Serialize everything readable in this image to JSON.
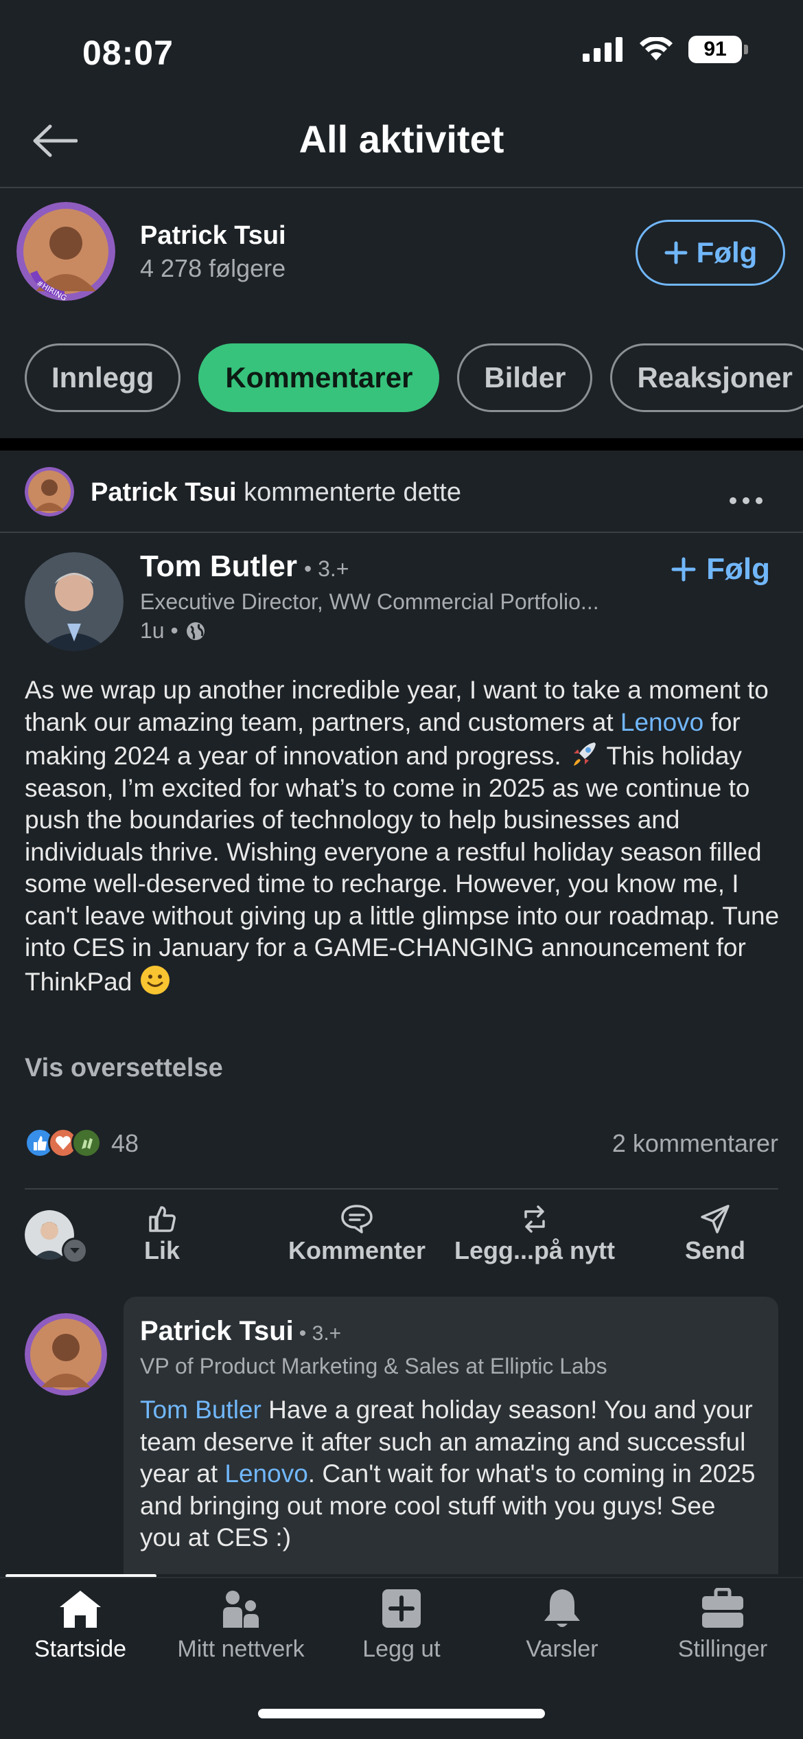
{
  "status_bar": {
    "time": "08:07",
    "battery": "91"
  },
  "header": {
    "title": "All aktivitet"
  },
  "profile": {
    "name": "Patrick Tsui",
    "followers": "4 278 følgere",
    "follow_label": "Følg",
    "avatar_badge": "#HIRING"
  },
  "filters": [
    {
      "label": "Innlegg",
      "active": false
    },
    {
      "label": "Kommentarer",
      "active": true
    },
    {
      "label": "Bilder",
      "active": false
    },
    {
      "label": "Reaksjoner",
      "active": false
    }
  ],
  "activity": {
    "actor": "Patrick Tsui",
    "action": "kommenterte dette"
  },
  "post": {
    "author": "Tom Butler",
    "degree": "• 3.+",
    "headline": "Executive Director, WW Commercial Portfolio...",
    "time": "1u •",
    "follow_label": "Følg",
    "text_1": "As we wrap up another incredible year, I want to take a moment to thank our amazing team, partners, and customers at ",
    "mention": "Lenovo",
    "text_2": " for making 2024 a year of innovation and progress. ",
    "text_3": " This holiday season, I’m excited for what’s to come in 2025 as we continue to push the boundaries of technology to help businesses and individuals thrive. Wishing everyone a restful holiday season filled some well-deserved time to recharge. However, you know me, I can't leave without giving up a little glimpse into our roadmap. Tune into CES in January for a GAME-CHANGING announcement for ThinkPad ",
    "translate_label": "Vis oversettelse",
    "reaction_count": "48",
    "comment_count": "2 kommentarer",
    "reaction_icons": [
      "like-icon",
      "love-icon",
      "celebrate-icon"
    ]
  },
  "actions": {
    "like": "Lik",
    "comment": "Kommenter",
    "repost": "Legg...på nytt",
    "send": "Send"
  },
  "comment": {
    "author": "Patrick Tsui",
    "degree": "• 3.+",
    "headline": "VP of Product Marketing & Sales at Elliptic Labs",
    "mention_1": "Tom Butler",
    "text_1": " Have a great holiday season! You and your team deserve it after such an amazing and successful year at ",
    "mention_2": "Lenovo",
    "text_2": ". Can't wait for what's to coming in 2025 and bringing out more cool stuff with you guys! See you at CES :)"
  },
  "tabbar": {
    "home": "Startside",
    "network": "Mitt nettverk",
    "post": "Legg ut",
    "notifications": "Varsler",
    "jobs": "Stillinger"
  },
  "colors": {
    "accent": "#71b7fb",
    "active_chip": "#37c37c",
    "background": "#1d2226"
  }
}
